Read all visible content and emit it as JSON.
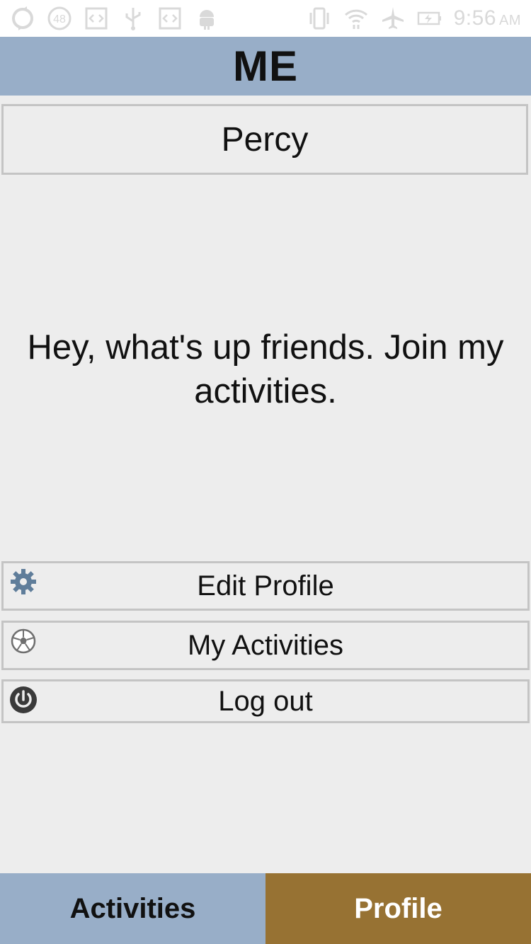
{
  "status_bar": {
    "time": "9:56",
    "ampm": "AM",
    "badge_count": "48",
    "icons": [
      "sync-icon",
      "notification-count-icon",
      "code-icon",
      "usb-icon",
      "code-icon",
      "android-icon",
      "vibrate-icon",
      "wifi-icon",
      "airplane-icon",
      "battery-charging-icon"
    ]
  },
  "header": {
    "title": "ME"
  },
  "profile": {
    "name": "Percy",
    "bio": "Hey, what's up friends. Join my activities."
  },
  "menu": {
    "edit_profile": {
      "label": "Edit Profile",
      "icon": "gear-icon"
    },
    "my_activities": {
      "label": "My Activities",
      "icon": "soccer-ball-icon"
    },
    "log_out": {
      "label": "Log out",
      "icon": "power-icon"
    }
  },
  "tabs": {
    "activities": {
      "label": "Activities"
    },
    "profile": {
      "label": "Profile",
      "active": true
    }
  },
  "colors": {
    "header_bg": "#98aec8",
    "tab_inactive_bg": "#98aec8",
    "tab_active_bg": "#977233",
    "page_bg": "#ededed",
    "border": "#c4c4c4"
  }
}
